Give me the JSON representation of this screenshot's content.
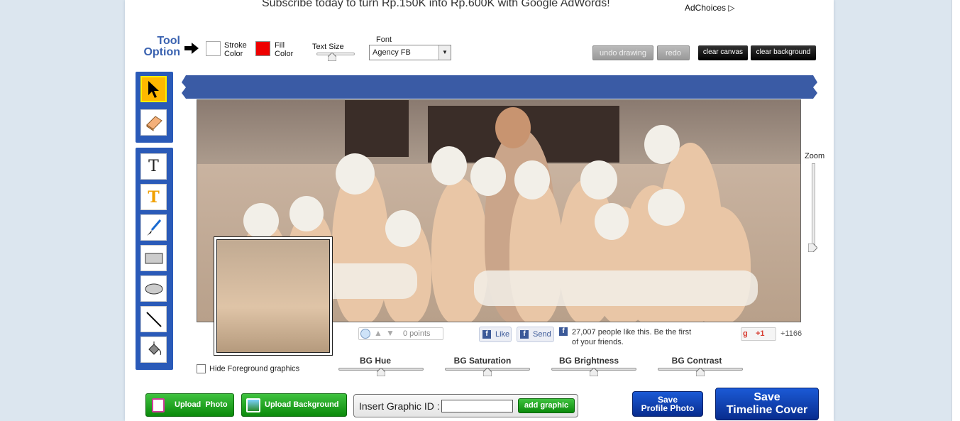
{
  "ad": {
    "text": "Subscribe today to turn Rp.150K into Rp.600K with Google AdWords!",
    "adchoices": "AdChoices"
  },
  "toolbar": {
    "tool_option_line1": "Tool",
    "tool_option_line2": "Option",
    "stroke_color_line1": "Stroke",
    "stroke_color_line2": "Color",
    "stroke_color_value": "#ffffff",
    "fill_color_line1": "Fill",
    "fill_color_line2": "Color",
    "fill_color_value": "#ee0000",
    "text_size_label": "Text Size",
    "font_label": "Font",
    "font_value": "Agency FB",
    "undo_label": "undo drawing",
    "redo_label": "redo",
    "clear_canvas_label": "clear canvas",
    "clear_background_label": "clear background"
  },
  "tools": [
    {
      "name": "select-tool",
      "icon": "cursor-icon",
      "active": true
    },
    {
      "name": "eraser-tool",
      "icon": "eraser-icon",
      "active": false
    },
    {
      "name": "text-tool",
      "icon": "text-T-icon",
      "active": false
    },
    {
      "name": "styled-text-tool",
      "icon": "text-styled-icon",
      "active": false
    },
    {
      "name": "brush-tool",
      "icon": "brush-icon",
      "active": false
    },
    {
      "name": "rectangle-tool",
      "icon": "rectangle-icon",
      "active": false
    },
    {
      "name": "ellipse-tool",
      "icon": "ellipse-icon",
      "active": false
    },
    {
      "name": "line-tool",
      "icon": "line-icon",
      "active": false
    },
    {
      "name": "fill-tool",
      "icon": "paint-bucket-icon",
      "active": false
    }
  ],
  "zoom": {
    "label": "Zoom"
  },
  "social": {
    "points": "0 points",
    "like_label": "Like",
    "send_label": "Send",
    "fb_text": "27,007 people like this. Be the first of your friends.",
    "gplus_label": "+1",
    "gplus_count": "+1166"
  },
  "controls": {
    "hide_fg_label": "Hide Foreground graphics",
    "bg_hue": "BG Hue",
    "bg_saturation": "BG Saturation",
    "bg_brightness": "BG Brightness",
    "bg_contrast": "BG Contrast"
  },
  "bottom": {
    "upload_photo": "Upload  Photo",
    "upload_background": "Upload Background",
    "insert_graphic_label": "Insert Graphic ID :",
    "insert_graphic_value": "",
    "add_graphic": "add graphic",
    "save_profile_line1": "Save",
    "save_profile_line2": "Profile Photo",
    "save_timeline_line1": "Save",
    "save_timeline_line2": "Timeline Cover"
  },
  "colors": {
    "accent": "#2a5ab8",
    "banner": "#3a5ba5",
    "green": "#0b8a0b",
    "blue": "#082c8e"
  }
}
